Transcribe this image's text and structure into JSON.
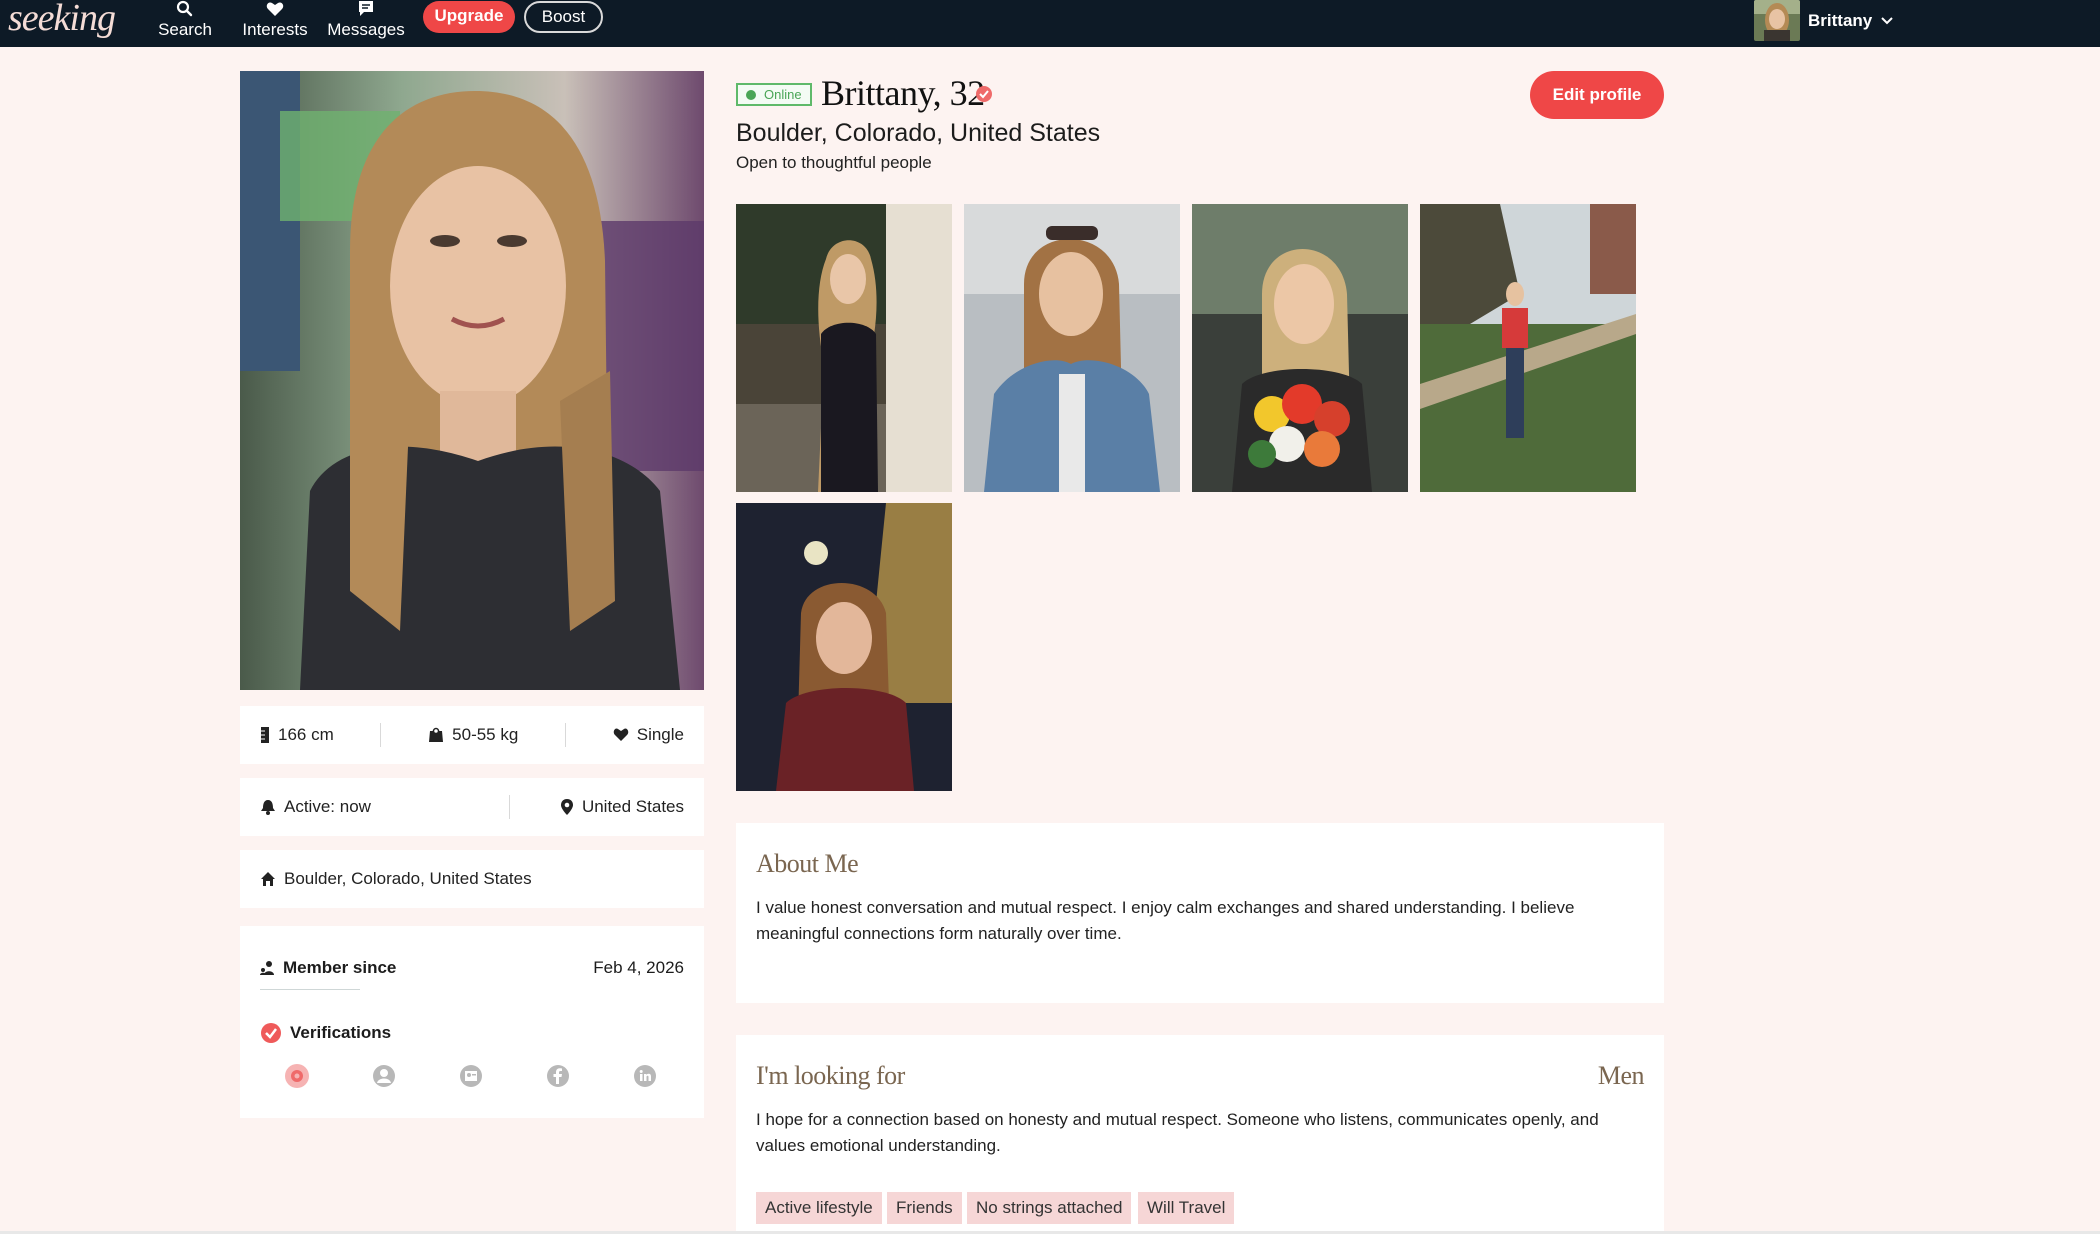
{
  "nav": {
    "logo": "seeking",
    "items": [
      {
        "label": "Search",
        "icon": "search-icon"
      },
      {
        "label": "Interests",
        "icon": "heart-icon"
      },
      {
        "label": "Messages",
        "icon": "chat-icon"
      }
    ],
    "upgrade_label": "Upgrade",
    "boost_label": "Boost",
    "user_name": "Brittany"
  },
  "profile": {
    "status": "Online",
    "name_age": "Brittany, 32",
    "location": "Boulder, Colorado, United States",
    "tagline": "Open to thoughtful people",
    "edit_label": "Edit profile"
  },
  "stats": {
    "height": "166 cm",
    "weight": "50-55 kg",
    "relationship": "Single",
    "active": "Active: now",
    "country": "United States",
    "home": "Boulder, Colorado, United States",
    "member_since_label": "Member since",
    "member_since_value": "Feb 4, 2026",
    "verifications_label": "Verifications"
  },
  "about": {
    "title": "About Me",
    "text": "I value honest conversation and mutual respect. I enjoy calm exchanges and shared understanding. I believe meaningful connections form naturally over time."
  },
  "looking_for": {
    "title": "I'm looking for",
    "target": "Men",
    "text": "I hope for a connection based on honesty and mutual respect. Someone who listens, communicates openly, and values emotional understanding.",
    "tags": [
      "Active lifestyle",
      "Friends",
      "No strings attached",
      "Will Travel"
    ]
  },
  "colors": {
    "nav_bg": "#0d1a26",
    "accent": "#ef4747",
    "page_bg": "#fdf3f1",
    "online": "#4aa556",
    "tag_bg": "#f6d6d6"
  }
}
